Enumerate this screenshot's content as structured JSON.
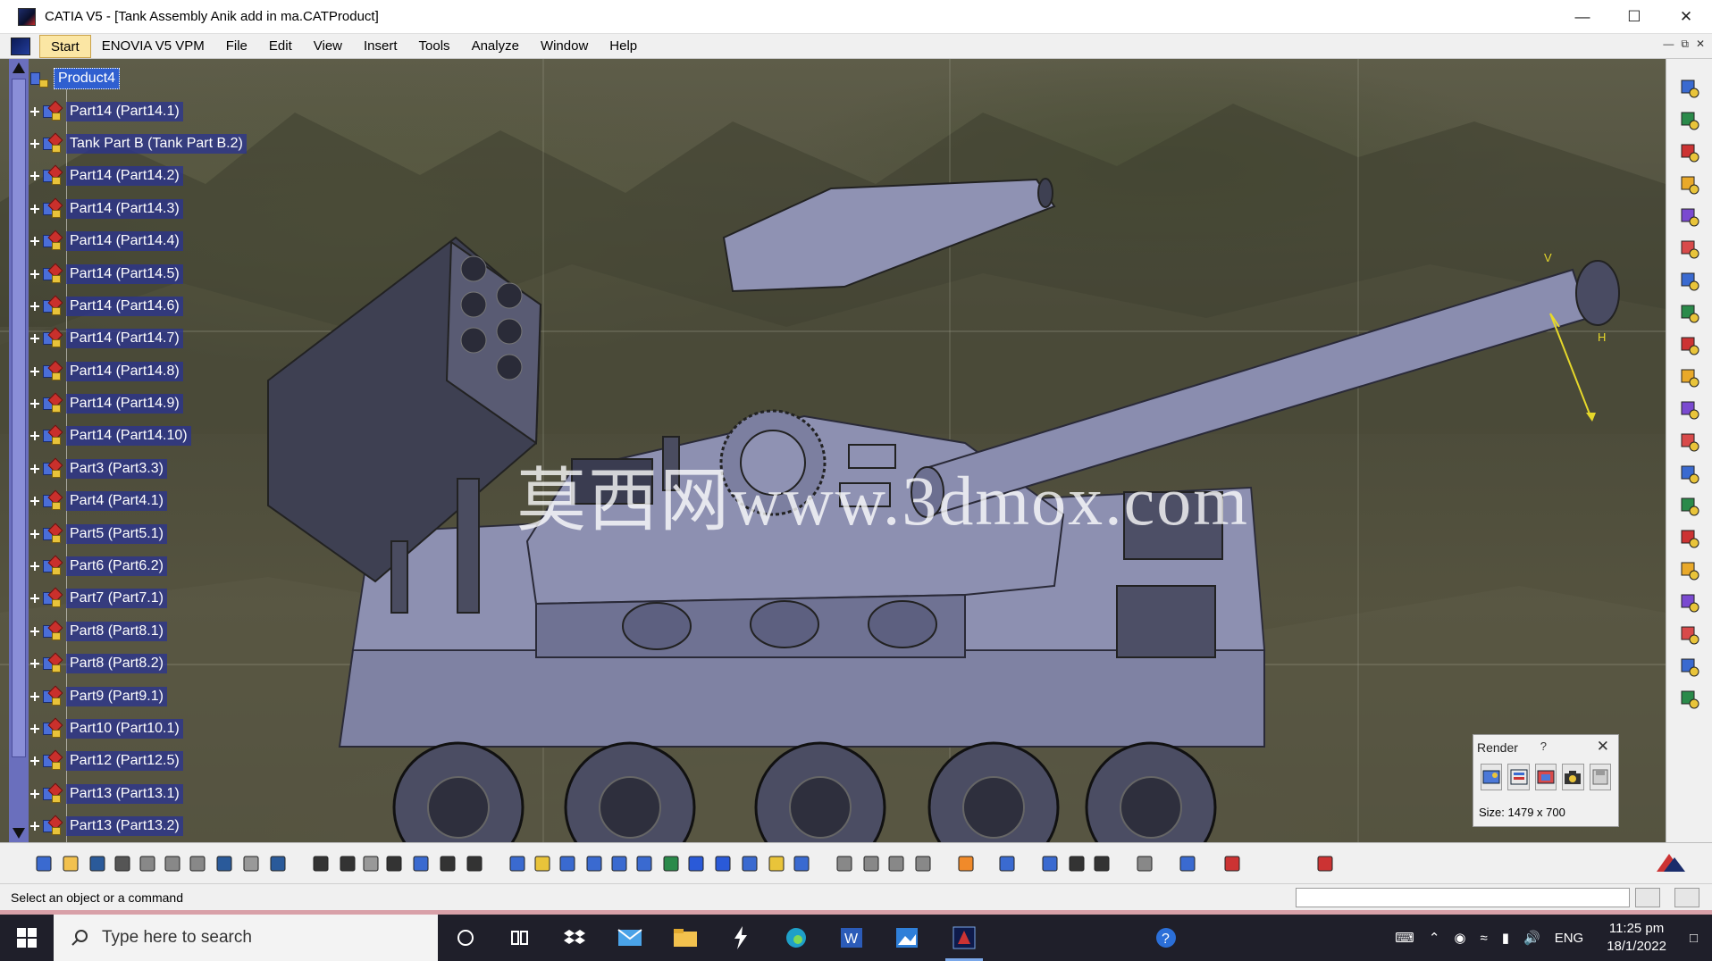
{
  "window": {
    "title": "CATIA V5 - [Tank Assembly Anik add in ma.CATProduct]",
    "minimize": "—",
    "maximize": "☐",
    "close": "✕"
  },
  "menu": {
    "items": [
      "Start",
      "ENOVIA V5 VPM",
      "File",
      "Edit",
      "View",
      "Insert",
      "Tools",
      "Analyze",
      "Window",
      "Help"
    ]
  },
  "tree": {
    "root": "Product4",
    "nodes": [
      "Part14 (Part14.1)",
      "Tank Part B (Tank Part B.2)",
      "Part14 (Part14.2)",
      "Part14 (Part14.3)",
      "Part14 (Part14.4)",
      "Part14 (Part14.5)",
      "Part14 (Part14.6)",
      "Part14 (Part14.7)",
      "Part14 (Part14.8)",
      "Part14 (Part14.9)",
      "Part14 (Part14.10)",
      "Part3 (Part3.3)",
      "Part4 (Part4.1)",
      "Part5 (Part5.1)",
      "Part6 (Part6.2)",
      "Part7 (Part7.1)",
      "Part8 (Part8.1)",
      "Part8 (Part8.2)",
      "Part9 (Part9.1)",
      "Part10 (Part10.1)",
      "Part12 (Part12.5)",
      "Part13 (Part13.1)",
      "Part13 (Part13.2)"
    ]
  },
  "viewport": {
    "watermark": "莫西网www.3dmox.com",
    "compass_labels": [
      "V",
      "H"
    ]
  },
  "render_panel": {
    "title": "Render",
    "help": "?",
    "close": "✕",
    "size_text": "Size: 1479 x 700"
  },
  "status": {
    "message": "Select an object or a command"
  },
  "taskbar": {
    "search_placeholder": "Type here to search",
    "language": "ENG",
    "time": "11:25 pm",
    "date": "18/1/2022"
  },
  "colors": {
    "tree_highlight": "#2f5fd0",
    "tank_body": "#8c8fb0",
    "terrain": "#565540"
  }
}
